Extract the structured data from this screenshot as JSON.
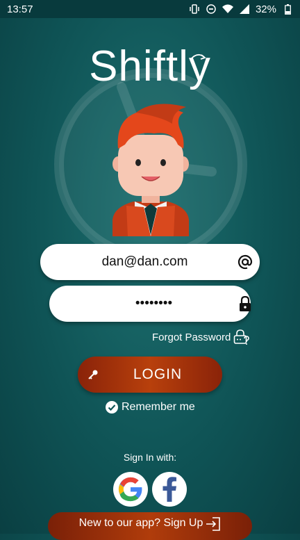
{
  "status_bar": {
    "time": "13:57",
    "battery": "32%"
  },
  "app": {
    "logo_text": "Shiftly"
  },
  "login_form": {
    "email_value": "dan@dan.com",
    "password_value": "••••••••",
    "email_icon": "at-sign-icon",
    "password_icon": "lock-icon",
    "forgot_password_label": "Forgot Password",
    "login_label": "LOGIN",
    "remember_me_label": "Remember me"
  },
  "social": {
    "heading": "Sign In with:",
    "providers": [
      "google",
      "facebook"
    ]
  },
  "signup": {
    "label": "New to our app? Sign Up"
  },
  "colors": {
    "background": "#0f5456",
    "button": "#b03c0b",
    "field": "#ffffff"
  }
}
